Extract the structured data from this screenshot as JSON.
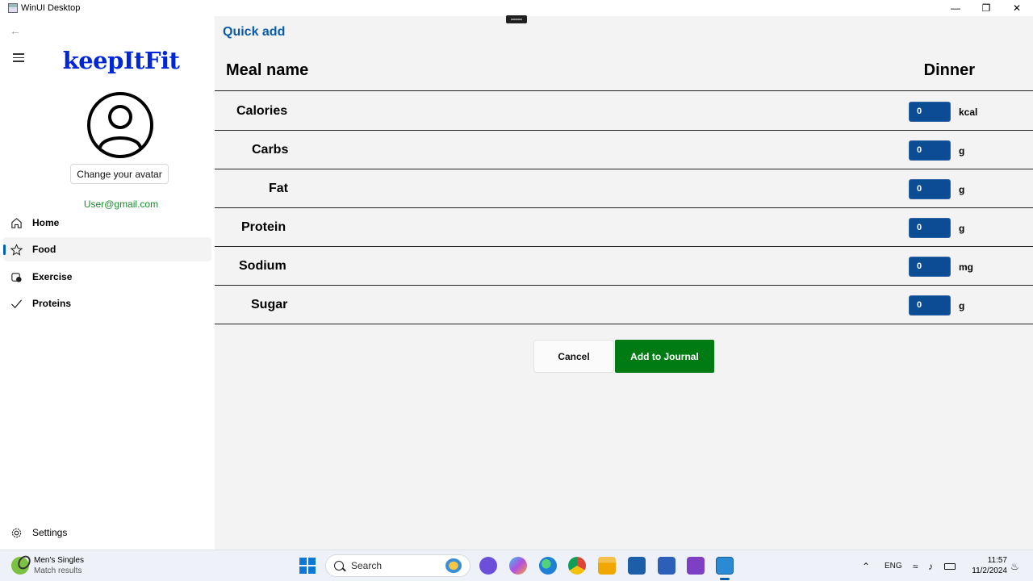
{
  "window": {
    "title": "WinUI Desktop",
    "controls": {
      "minimize": "—",
      "maximize": "❐",
      "close": "✕"
    }
  },
  "nav": {
    "logo": "keepItFit",
    "avatar_button": "Change your avatar",
    "email": "User@gmail.com",
    "items": [
      {
        "label": "Home",
        "icon": "home-icon",
        "selected": false
      },
      {
        "label": "Food",
        "icon": "star-icon",
        "selected": true
      },
      {
        "label": "Exercise",
        "icon": "exercise-icon",
        "selected": false
      },
      {
        "label": "Proteins",
        "icon": "checkmark-icon",
        "selected": false
      }
    ],
    "settings": "Settings"
  },
  "main": {
    "title": "Quick add",
    "meal_label": "Meal name",
    "meal_value": "Dinner",
    "rows": [
      {
        "label": "Calories",
        "value": "0",
        "unit": "kcal"
      },
      {
        "label": "Carbs",
        "value": "0",
        "unit": "g"
      },
      {
        "label": "Fat",
        "value": "0",
        "unit": "g"
      },
      {
        "label": "Protein",
        "value": "0",
        "unit": "g"
      },
      {
        "label": "Sodium",
        "value": "0",
        "unit": "mg"
      },
      {
        "label": "Sugar",
        "value": "0",
        "unit": "g"
      }
    ],
    "cancel": "Cancel",
    "add": "Add to Journal"
  },
  "taskbar": {
    "weather_title": "Men's Singles",
    "weather_sub": "Match results",
    "search": "Search",
    "lang": "ENG",
    "time": "11:57",
    "date": "11/2/2024"
  },
  "colors": {
    "accent": "#0a5cab",
    "logo": "#0026d6",
    "email": "#188a2e",
    "input": "#0b4c95",
    "add_button": "#007a12"
  }
}
